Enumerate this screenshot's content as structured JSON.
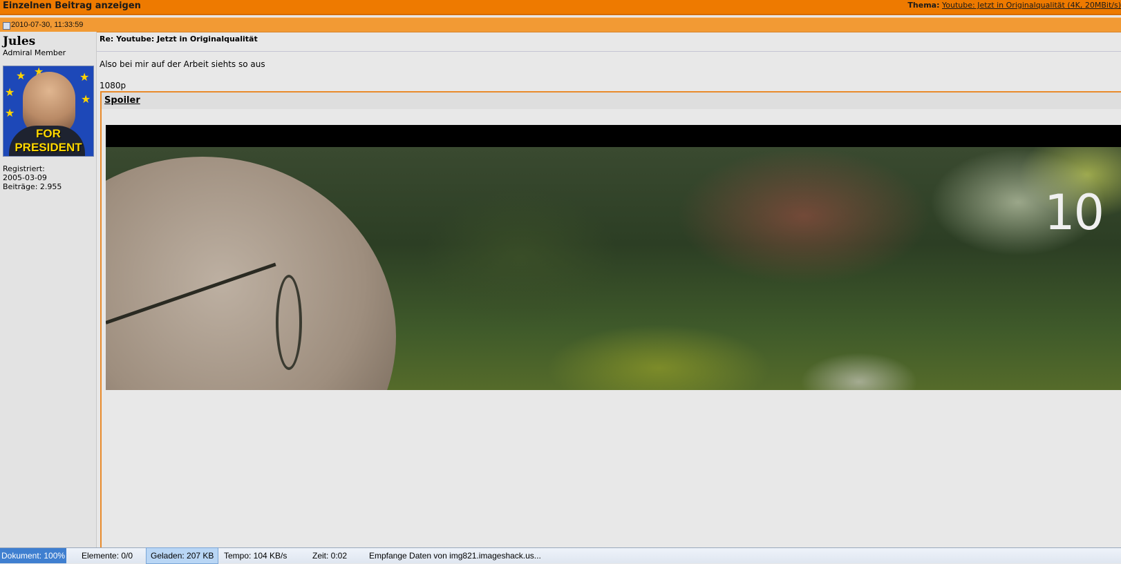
{
  "header": {
    "title": "Einzelnen Beitrag anzeigen",
    "thema_label": "Thema:",
    "thema_link": "Youtube: Jetzt in Originalqualität (4K, 20MBit/s)"
  },
  "post": {
    "date": "2010-07-30, 11:33:59",
    "subject": "Re: Youtube: Jetzt in Originalqualität",
    "body": "Also bei mir auf der Arbeit siehts so aus",
    "resolution": "1080p",
    "spoiler_label": "Spoiler",
    "video_overlay_text": "10"
  },
  "user": {
    "name": "Jules",
    "title": "Admiral Member",
    "avatar_banner": "FOR PRESIDENT",
    "registered_label": "Registriert:",
    "registered_date": "2005-03-09",
    "posts_label": "Beiträge: 2.955"
  },
  "statusbar": {
    "dokument": "Dokument:  100%",
    "elemente": "Elemente:   0/0",
    "geladen": "Geladen:   207 KB",
    "tempo": "Tempo:   104 KB/s",
    "zeit": "Zeit:   0:02",
    "message": "Empfange Daten von img821.imageshack.us..."
  },
  "colors": {
    "header_orange": "#ee7a00",
    "date_orange": "#f29a34",
    "spoiler_border": "#e88a2a"
  }
}
